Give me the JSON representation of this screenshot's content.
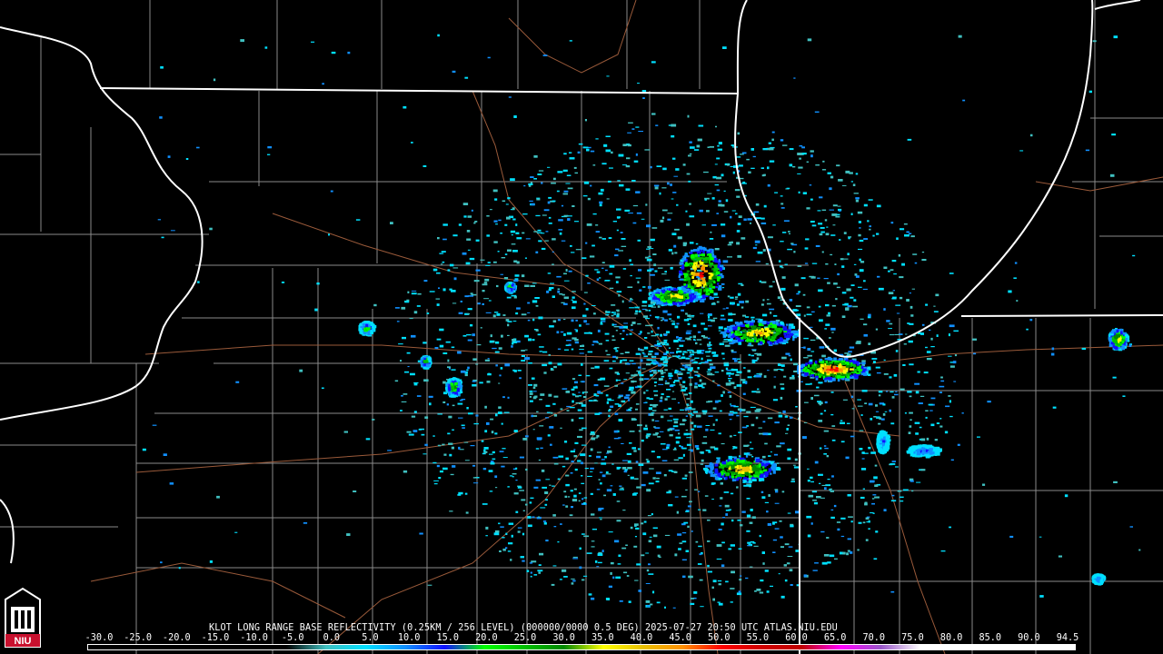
{
  "product": {
    "caption": "KLOT LONG RANGE BASE REFLECTIVITY (0.25KM / 256 LEVEL) (000000/0000 0.5 DEG) 2025-07-27 20:50 UTC  ATLAS.NIU.EDU"
  },
  "legend": {
    "labels": [
      "-30.0",
      "-25.0",
      "-20.0",
      "-15.0",
      "-10.0",
      "-5.0",
      "0.0",
      "5.0",
      "10.0",
      "15.0",
      "20.0",
      "25.0",
      "30.0",
      "35.0",
      "40.0",
      "45.0",
      "50.0",
      "55.0",
      "60.0",
      "65.0",
      "70.0",
      "75.0",
      "80.0",
      "85.0",
      "90.0",
      "94.5"
    ],
    "min_dbz": -30,
    "max_dbz": 94.5,
    "stops": [
      {
        "dbz": -30,
        "color": "#000000"
      },
      {
        "dbz": -5,
        "color": "#000000"
      },
      {
        "dbz": 0,
        "color": "#40c0c0"
      },
      {
        "dbz": 5,
        "color": "#00e0ff"
      },
      {
        "dbz": 10,
        "color": "#1090ff"
      },
      {
        "dbz": 15,
        "color": "#1010ff"
      },
      {
        "dbz": 20,
        "color": "#00ff00"
      },
      {
        "dbz": 25,
        "color": "#00c000"
      },
      {
        "dbz": 30,
        "color": "#008800"
      },
      {
        "dbz": 35,
        "color": "#ffff00"
      },
      {
        "dbz": 40,
        "color": "#e8c000"
      },
      {
        "dbz": 45,
        "color": "#ff9000"
      },
      {
        "dbz": 50,
        "color": "#ff0000"
      },
      {
        "dbz": 55,
        "color": "#d00000"
      },
      {
        "dbz": 60,
        "color": "#c00000"
      },
      {
        "dbz": 65,
        "color": "#ff00ff"
      },
      {
        "dbz": 70,
        "color": "#9955c9"
      },
      {
        "dbz": 75,
        "color": "#ffffff"
      },
      {
        "dbz": 94.5,
        "color": "#ffffff"
      }
    ]
  },
  "logo": {
    "text": "NIU",
    "color": "#c8102e"
  },
  "colors": {
    "background": "#000000",
    "state_border": "#ffffff",
    "county_border": "#8a8a8a",
    "highway": "#9a5a3a"
  }
}
